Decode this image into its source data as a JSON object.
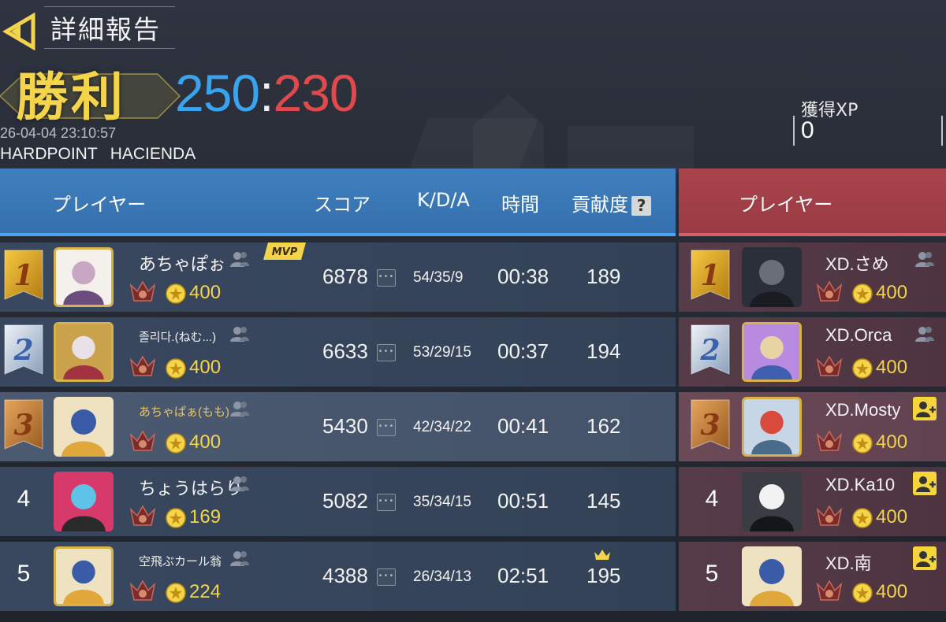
{
  "header": {
    "back_icon": "back-arrow-icon",
    "title": "詳細報告",
    "result": "勝利",
    "score_blue": "250",
    "score_sep": ":",
    "score_red": "230",
    "datetime": "26-04-04 23:10:57",
    "mode": "HARDPOINT",
    "map": "HACIENDA",
    "xp_label": "獲得XP",
    "xp_value": "0"
  },
  "columns": {
    "player": "プレイヤー",
    "score": "スコア",
    "kda": "K/D/A",
    "time": "時間",
    "contribution": "貢献度",
    "help": "?",
    "enemy_player": "プレイヤー"
  },
  "colors": {
    "blue_team": "#3670ad",
    "red_team": "#9a3a44",
    "gold": "#f3d44a",
    "score_blue": "#3aa3ee",
    "score_red": "#e14a4d"
  },
  "blue_team": [
    {
      "rank": "1",
      "name": "あちゃぽぉ",
      "coins": "400",
      "mvp": "MVP",
      "score": "6878",
      "kda": "54/35/9",
      "time": "00:38",
      "contribution": "189",
      "more": "•••"
    },
    {
      "rank": "2",
      "name": "졸리다.(ねむ...)",
      "coins": "400",
      "score": "6633",
      "kda": "53/29/15",
      "time": "00:37",
      "contribution": "194",
      "more": "•••"
    },
    {
      "rank": "3",
      "name": "あちゃぱぁ(もも)",
      "coins": "400",
      "score": "5430",
      "kda": "42/34/22",
      "time": "00:41",
      "contribution": "162",
      "more": "•••"
    },
    {
      "rank": "4",
      "name": "ちょうはらり",
      "coins": "169",
      "score": "5082",
      "kda": "35/34/15",
      "time": "00:51",
      "contribution": "145",
      "more": "•••"
    },
    {
      "rank": "5",
      "name": "空飛ぶカール翁",
      "coins": "224",
      "score": "4388",
      "kda": "26/34/13",
      "time": "02:51",
      "contribution": "195",
      "more": "•••"
    }
  ],
  "red_team": [
    {
      "rank": "1",
      "name": "XD.さめ",
      "coins": "400",
      "action": "friend-icon"
    },
    {
      "rank": "2",
      "name": "XD.Orca",
      "coins": "400",
      "action": "friend-icon"
    },
    {
      "rank": "3",
      "name": "XD.Mosty",
      "coins": "400",
      "action": "add-friend-icon"
    },
    {
      "rank": "4",
      "name": "XD.Ka10",
      "coins": "400",
      "action": "add-friend-icon"
    },
    {
      "rank": "5",
      "name": "XD.南",
      "coins": "400",
      "action": "add-friend-icon"
    }
  ]
}
